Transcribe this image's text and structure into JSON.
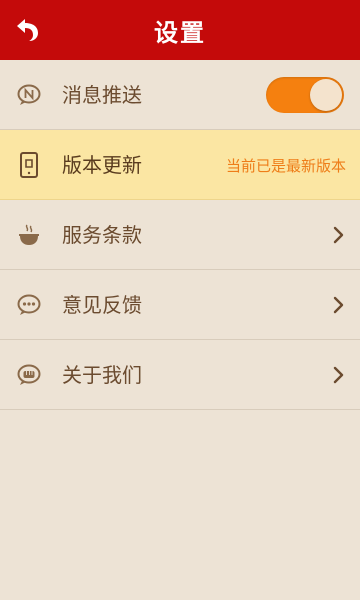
{
  "header": {
    "title": "设置",
    "back_icon": "back-arrow-icon"
  },
  "settings": {
    "push": {
      "label": "消息推送",
      "icon": "notification-n-icon",
      "enabled": true
    },
    "update": {
      "label": "版本更新",
      "icon": "phone-update-icon",
      "status": "当前已是最新版本"
    },
    "terms": {
      "label": "服务条款",
      "icon": "bowl-icon"
    },
    "feedback": {
      "label": "意见反馈",
      "icon": "chat-bubble-icon"
    },
    "about": {
      "label": "关于我们",
      "icon": "fist-icon"
    }
  },
  "colors": {
    "header": "#c40a0a",
    "background": "#ede3d5",
    "highlight": "#fbe6a3",
    "toggle_on": "#f5800f",
    "status_text": "#ee7d19",
    "text": "#6b4b2f"
  }
}
